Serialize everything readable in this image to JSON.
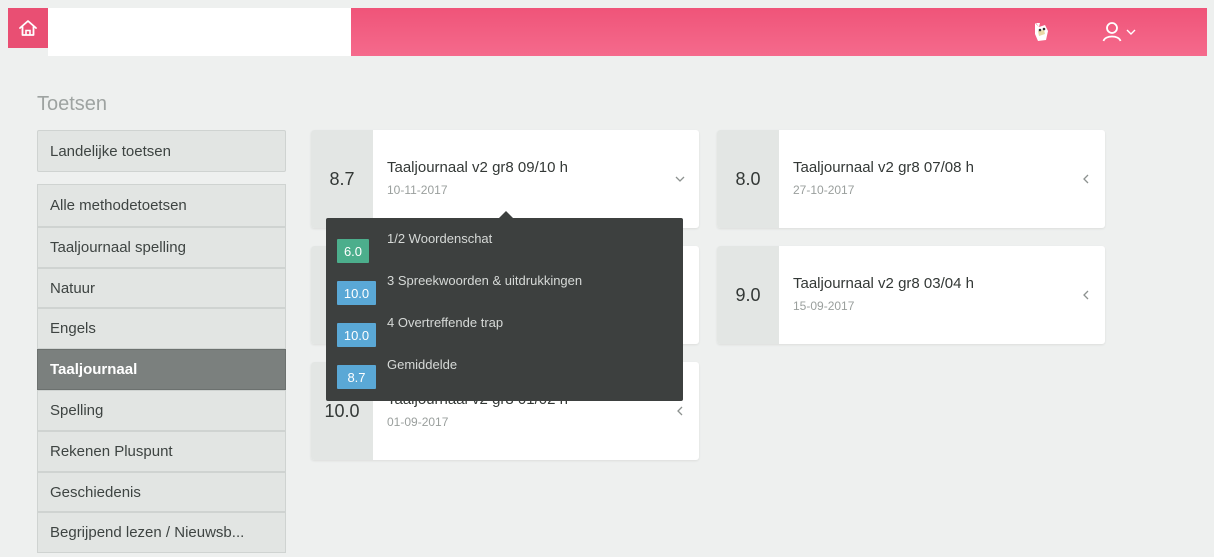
{
  "header": {
    "home_icon": "home-icon",
    "owl_icon": "owl-icon",
    "user_icon": "user-icon",
    "user_chevron_icon": "chevron-down-icon",
    "accent_color": "#ef5479"
  },
  "sidebar": {
    "title": "Toetsen",
    "national_label": "Landelijke toetsen",
    "items": [
      {
        "label": "Alle methodetoetsen"
      },
      {
        "label": "Taaljournaal spelling"
      },
      {
        "label": "Natuur"
      },
      {
        "label": "Engels"
      },
      {
        "label": "Taaljournaal"
      },
      {
        "label": "Spelling"
      },
      {
        "label": "Rekenen Pluspunt"
      },
      {
        "label": "Geschiedenis"
      },
      {
        "label": "Begrijpend lezen / Nieuwsb..."
      }
    ],
    "active_item": "Taaljournaal"
  },
  "cards": [
    {
      "score": "8.7",
      "title": "Taaljournaal v2 gr8 09/10 h",
      "date": "10-11-2017",
      "chevron": "chevron-down-icon"
    },
    {
      "score": "8.0",
      "title": "Taaljournaal v2 gr8 07/08 h",
      "date": "27-10-2017",
      "chevron": "chevron-left-icon"
    },
    {
      "score": "",
      "title": "",
      "date": "",
      "chevron": "chevron-left-icon"
    },
    {
      "score": "9.0",
      "title": "Taaljournaal v2 gr8 03/04 h",
      "date": "15-09-2017",
      "chevron": "chevron-left-icon"
    },
    {
      "score": "10.0",
      "title": "Taaljournaal v2 gr8 01/02 h",
      "date": "01-09-2017",
      "chevron": "chevron-left-icon"
    }
  ],
  "tooltip": {
    "rows": [
      {
        "score": "6.0",
        "label": "1/2 Woordenschat",
        "color": "#4cae8c"
      },
      {
        "score": "10.0",
        "label": "3 Spreekwoorden & uitdrukkingen",
        "color": "#5aa8d6"
      },
      {
        "score": "10.0",
        "label": "4 Overtreffende trap",
        "color": "#5aa8d6"
      },
      {
        "score": "8.7",
        "label": "Gemiddelde",
        "color": "#5aa8d6"
      }
    ]
  }
}
